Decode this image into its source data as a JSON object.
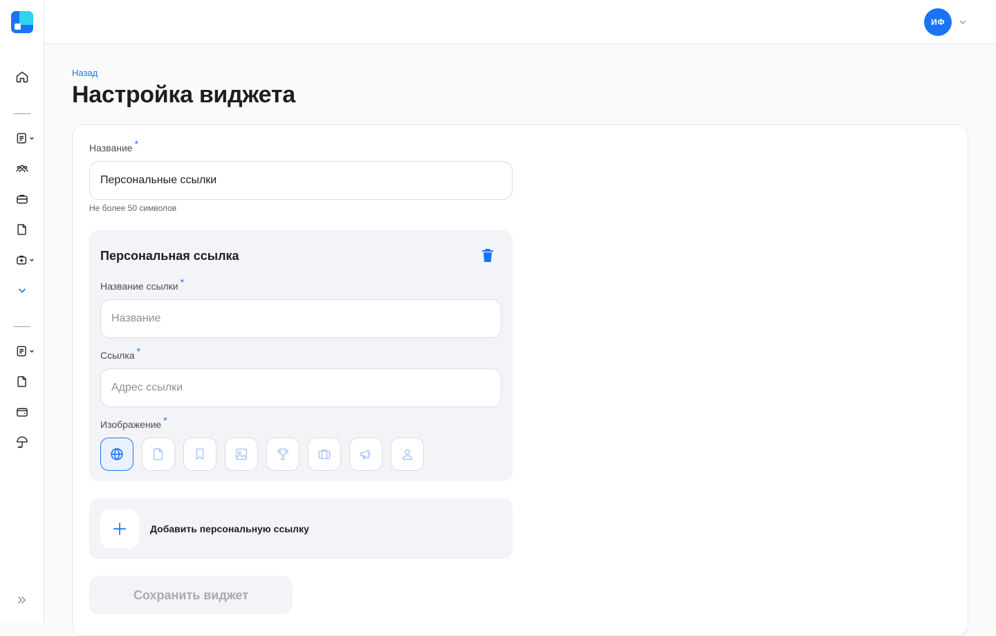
{
  "topbar": {
    "avatar_initials": "ИФ"
  },
  "page": {
    "back_label": "Назад",
    "title": "Настройка виджета"
  },
  "form": {
    "name_label": "Название",
    "required_mark": "*",
    "name_value": "Персональные ссылки",
    "name_hint": "Не более 50 символов",
    "link_block": {
      "title": "Персональная ссылка",
      "link_name_label": "Название ссылки",
      "link_name_placeholder": "Название",
      "link_url_label": "Ссылка",
      "link_url_placeholder": "Адрес ссылки",
      "image_label": "Изображение",
      "image_options": [
        "globe-icon",
        "file-icon",
        "bookmark-icon",
        "image-icon",
        "trophy-icon",
        "briefcase-icon",
        "megaphone-icon",
        "user-icon"
      ],
      "selected_image": "globe-icon"
    },
    "add_link_label": "Добавить персональную ссылку",
    "save_label": "Сохранить виджет"
  },
  "colors": {
    "accent": "#1a73f5",
    "cyan": "#2fd3f2",
    "panel": "#f3f4f7"
  }
}
